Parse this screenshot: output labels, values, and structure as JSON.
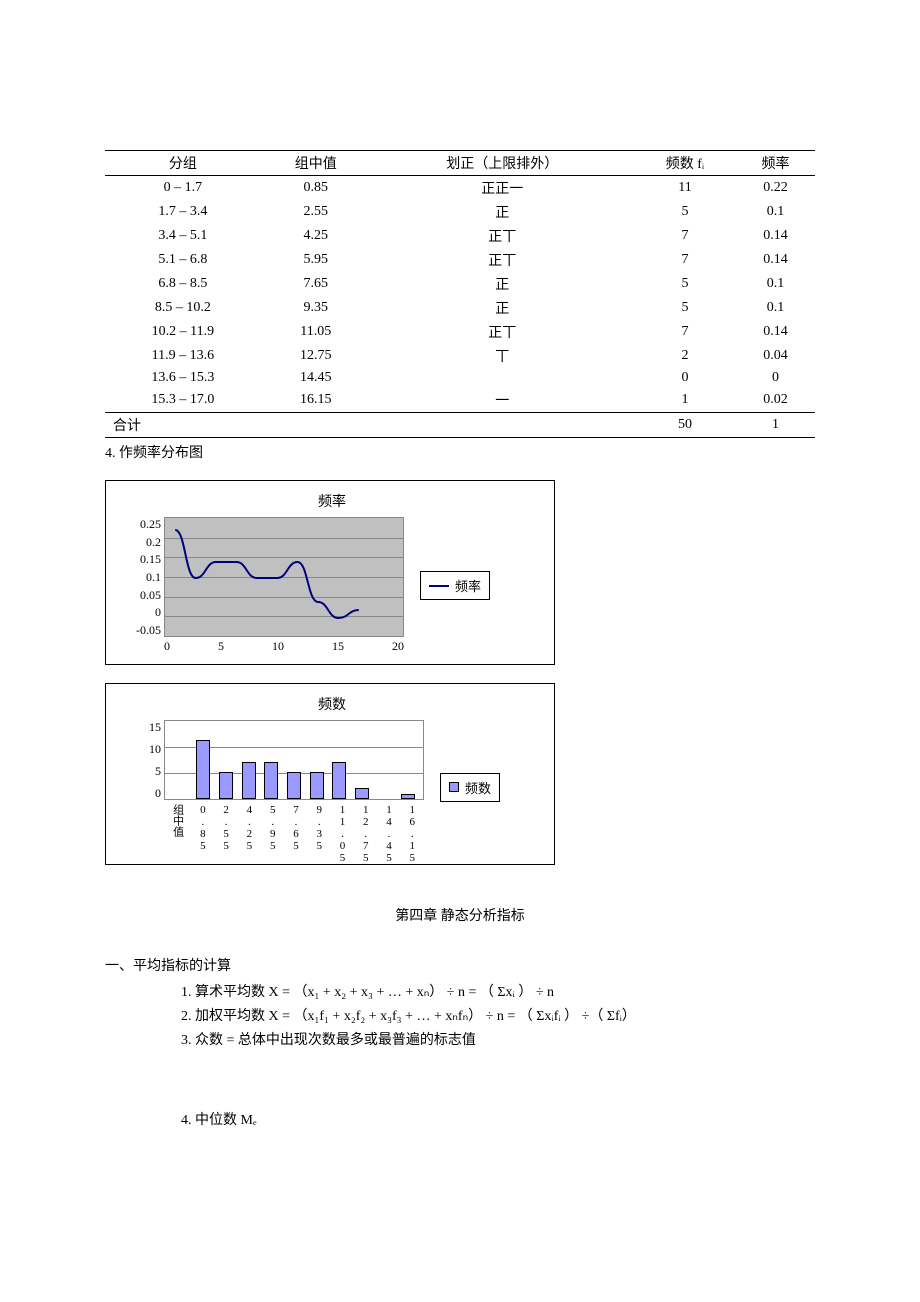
{
  "table": {
    "headers": [
      "分组",
      "组中值",
      "划正（上限排外）",
      "频数 fᵢ",
      "频率"
    ],
    "rows": [
      {
        "range": "0 – 1.7",
        "mid": "0.85",
        "tally": "正正一",
        "freq": "11",
        "rate": "0.22"
      },
      {
        "range": "1.7 – 3.4",
        "mid": "2.55",
        "tally": "正",
        "freq": "5",
        "rate": "0.1"
      },
      {
        "range": "3.4 – 5.1",
        "mid": "4.25",
        "tally": "正丅",
        "freq": "7",
        "rate": "0.14"
      },
      {
        "range": "5.1 – 6.8",
        "mid": "5.95",
        "tally": "正丅",
        "freq": "7",
        "rate": "0.14"
      },
      {
        "range": "6.8 – 8.5",
        "mid": "7.65",
        "tally": "正",
        "freq": "5",
        "rate": "0.1"
      },
      {
        "range": "8.5 – 10.2",
        "mid": "9.35",
        "tally": "正",
        "freq": "5",
        "rate": "0.1"
      },
      {
        "range": "10.2 – 11.9",
        "mid": "11.05",
        "tally": "正丅",
        "freq": "7",
        "rate": "0.14"
      },
      {
        "range": "11.9 – 13.6",
        "mid": "12.75",
        "tally": "丅",
        "freq": "2",
        "rate": "0.04"
      },
      {
        "range": "13.6 – 15.3",
        "mid": "14.45",
        "tally": "",
        "freq": "0",
        "rate": "0"
      },
      {
        "range": "15.3 – 17.0",
        "mid": "16.15",
        "tally": "一",
        "freq": "1",
        "rate": "0.02"
      }
    ],
    "total_label": "合计",
    "total_freq": "50",
    "total_rate": "1"
  },
  "step4_label": "4. 作频率分布图",
  "chart_data": [
    {
      "type": "line",
      "title": "频率",
      "legend": "频率",
      "x": [
        0.85,
        2.55,
        4.25,
        5.95,
        7.65,
        9.35,
        11.05,
        12.75,
        14.45,
        16.15
      ],
      "y": [
        0.22,
        0.1,
        0.14,
        0.14,
        0.1,
        0.1,
        0.14,
        0.04,
        0,
        0.02
      ],
      "yticks": [
        "0.25",
        "0.2",
        "0.15",
        "0.1",
        "0.05",
        "0",
        "-0.05"
      ],
      "xticks": [
        "0",
        "5",
        "10",
        "15",
        "20"
      ],
      "ylim": [
        -0.05,
        0.25
      ],
      "xlim": [
        0,
        20
      ]
    },
    {
      "type": "bar",
      "title": "频数",
      "legend": "频数",
      "categories": [
        "组中值",
        "0.85",
        "2.55",
        "4.25",
        "5.95",
        "7.65",
        "9.35",
        "11.05",
        "12.75",
        "14.45",
        "16.15"
      ],
      "values": [
        null,
        11,
        5,
        7,
        7,
        5,
        5,
        7,
        2,
        0,
        1
      ],
      "yticks": [
        "15",
        "10",
        "5",
        "0"
      ],
      "ylim": [
        0,
        15
      ]
    }
  ],
  "chapter_title": "第四章  静态分析指标",
  "section1": {
    "head": "一、平均指标的计算",
    "items": [
      "算术平均数 X =  （x₁ + x₂ + x₃ + … + xₙ） ÷ n = （ Σxᵢ ） ÷ n",
      "加权平均数 X =  （x₁f₁ + x₂f₂ + x₃f₃ + … + xₙfₙ） ÷ n = （ Σxᵢfᵢ  ）  ÷（ Σfᵢ）",
      "众数  =  总体中出现次数最多或最普遍的标志值"
    ],
    "item4": "中位数  Mₑ"
  }
}
